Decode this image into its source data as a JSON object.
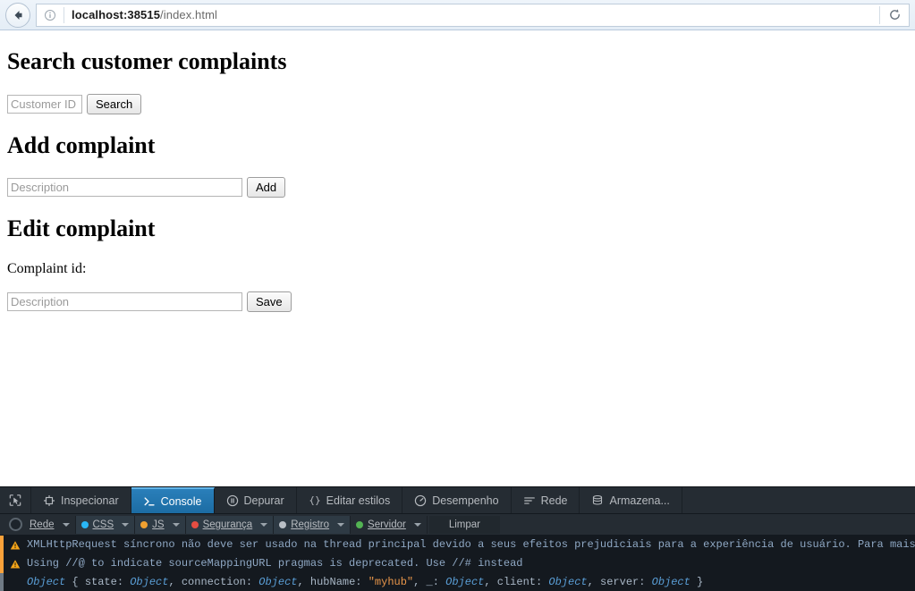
{
  "browser": {
    "back_icon": "back-arrow-icon",
    "identity_icon": "info-icon",
    "url_host": "localhost:38515",
    "url_path": "/index.html",
    "reload_icon": "reload-icon"
  },
  "page": {
    "search_section": {
      "heading": "Search customer complaints",
      "customer_id_placeholder": "Customer ID",
      "customer_id_value": "",
      "search_button": "Search"
    },
    "add_section": {
      "heading": "Add complaint",
      "description_placeholder": "Description",
      "description_value": "",
      "add_button": "Add"
    },
    "edit_section": {
      "heading": "Edit complaint",
      "complaint_id_label": "Complaint id:",
      "description_placeholder": "Description",
      "description_value": "",
      "save_button": "Save"
    }
  },
  "devtools": {
    "picker_icon": "element-picker-icon",
    "tabs": [
      {
        "label": "Inspecionar",
        "icon": "inspector-icon",
        "selected": false
      },
      {
        "label": "Console",
        "icon": "console-prompt-icon",
        "selected": true
      },
      {
        "label": "Depurar",
        "icon": "debugger-pause-icon",
        "selected": false
      },
      {
        "label": "Editar estilos",
        "icon": "style-editor-braces-icon",
        "selected": false
      },
      {
        "label": "Desempenho",
        "icon": "performance-gauge-icon",
        "selected": false
      },
      {
        "label": "Rede",
        "icon": "network-bars-icon",
        "selected": false
      },
      {
        "label": "Armazena...",
        "icon": "storage-database-icon",
        "selected": false
      }
    ],
    "filters": [
      {
        "label": "Rede",
        "dot": "toggle",
        "color": "#1d242b",
        "active": false,
        "caret": true
      },
      {
        "label": "CSS",
        "dot": "solid",
        "color": "#29b6f6",
        "active": true,
        "caret": true
      },
      {
        "label": "JS",
        "dot": "solid",
        "color": "#f0a030",
        "active": true,
        "caret": true
      },
      {
        "label": "Segurança",
        "dot": "solid",
        "color": "#e54d42",
        "active": true,
        "caret": true
      },
      {
        "label": "Registro",
        "dot": "solid",
        "color": "#b9bfc6",
        "active": true,
        "caret": true
      },
      {
        "label": "Servidor",
        "dot": "solid",
        "color": "#53b353",
        "active": false,
        "caret": true
      }
    ],
    "clear_button": "Limpar",
    "console_messages": [
      {
        "level": "warning",
        "icon": "warning-triangle-icon",
        "text": "XMLHttpRequest síncrono não deve ser usado na thread principal devido a seus efeitos prejudiciais para a experiência de usuário. Para mais i"
      },
      {
        "level": "warning",
        "icon": "warning-triangle-icon",
        "text": "Using //@ to indicate sourceMappingURL pragmas is deprecated. Use //# instead"
      },
      {
        "level": "log",
        "icon": "",
        "object_prefix": "Object",
        "tokens": [
          {
            "t": "key",
            "v": " { state: "
          },
          {
            "t": "obj",
            "v": "Object"
          },
          {
            "t": "key",
            "v": ", connection: "
          },
          {
            "t": "obj",
            "v": "Object"
          },
          {
            "t": "key",
            "v": ", hubName: "
          },
          {
            "t": "str",
            "v": "\"myhub\""
          },
          {
            "t": "key",
            "v": ", _: "
          },
          {
            "t": "obj",
            "v": "Object"
          },
          {
            "t": "key",
            "v": ", client: "
          },
          {
            "t": "obj",
            "v": "Object"
          },
          {
            "t": "key",
            "v": ", server: "
          },
          {
            "t": "obj",
            "v": "Object"
          },
          {
            "t": "key",
            "v": " }"
          }
        ]
      }
    ]
  },
  "colors": {
    "devtools_bg": "#14191f",
    "toolbar_bg": "#252c33",
    "selected_tab": "#1c6ca3",
    "warning_stripe": "#f9a13a",
    "log_stripe": "#6f7a85"
  }
}
